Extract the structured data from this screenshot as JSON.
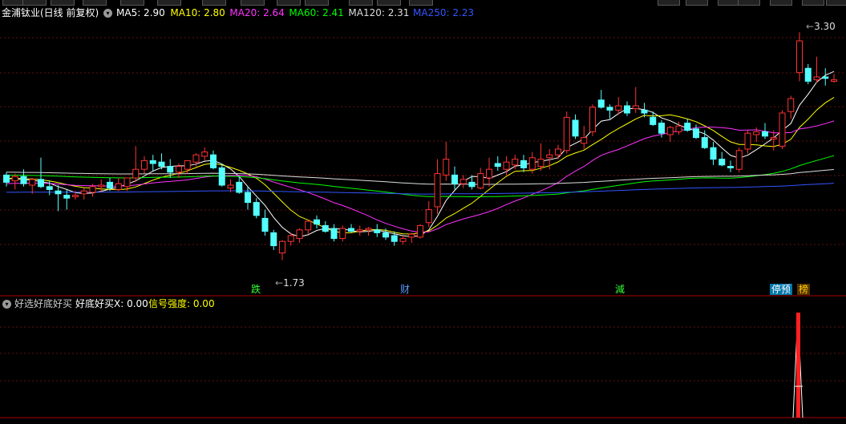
{
  "top_tabs": [
    "",
    "",
    "",
    "",
    "",
    "",
    "",
    "",
    "",
    "",
    "",
    "",
    ""
  ],
  "header": {
    "stock_title": "金浦钛业(日线 前复权)",
    "ma_labels": [
      {
        "label": "MA5: 2.90",
        "color": "#ffffff"
      },
      {
        "label": "MA10: 2.80",
        "color": "#ffff00"
      },
      {
        "label": "MA20: 2.64",
        "color": "#ff33ff"
      },
      {
        "label": "MA60: 2.41",
        "color": "#00ff00"
      },
      {
        "label": "MA120: 2.31",
        "color": "#dddddd"
      },
      {
        "label": "MA250: 2.23",
        "color": "#3355ff"
      }
    ]
  },
  "price_labels": {
    "high": "3.30",
    "low": "1.73"
  },
  "event_markers": [
    {
      "text": "跌",
      "color": "#33ff33",
      "bg": "transparent"
    },
    {
      "text": "财",
      "color": "#5599ff",
      "bg": "transparent"
    },
    {
      "text": "減",
      "color": "#33ff33",
      "bg": "transparent"
    },
    {
      "text": "停预",
      "color": "#ffffff",
      "bg": "#0077aa"
    },
    {
      "text": "榜",
      "color": "#ffcc00",
      "bg": "#553300"
    }
  ],
  "indicator": {
    "name": "好选好底好买",
    "value_label": "好底好买X: 0.00",
    "strength_label": "信号强度: 0.00"
  },
  "chart_data": {
    "type": "candlestick",
    "ylim": [
      1.6,
      3.4
    ],
    "candles": [
      [
        2.32,
        2.34,
        2.24,
        2.27
      ],
      [
        2.28,
        2.33,
        2.22,
        2.31
      ],
      [
        2.31,
        2.36,
        2.24,
        2.26
      ],
      [
        2.25,
        2.3,
        2.19,
        2.29
      ],
      [
        2.29,
        2.44,
        2.23,
        2.24
      ],
      [
        2.24,
        2.28,
        2.18,
        2.22
      ],
      [
        2.21,
        2.25,
        2.07,
        2.19
      ],
      [
        2.18,
        2.22,
        2.08,
        2.16
      ],
      [
        2.17,
        2.21,
        2.15,
        2.18
      ],
      [
        2.19,
        2.23,
        2.15,
        2.21
      ],
      [
        2.2,
        2.26,
        2.17,
        2.24
      ],
      [
        2.24,
        2.29,
        2.2,
        2.25
      ],
      [
        2.27,
        2.3,
        2.21,
        2.23
      ],
      [
        2.22,
        2.3,
        2.21,
        2.26
      ],
      [
        2.24,
        2.3,
        2.21,
        2.3
      ],
      [
        2.3,
        2.52,
        2.27,
        2.36
      ],
      [
        2.36,
        2.45,
        2.33,
        2.42
      ],
      [
        2.42,
        2.46,
        2.35,
        2.4
      ],
      [
        2.41,
        2.47,
        2.36,
        2.38
      ],
      [
        2.38,
        2.43,
        2.3,
        2.34
      ],
      [
        2.34,
        2.4,
        2.3,
        2.38
      ],
      [
        2.36,
        2.42,
        2.33,
        2.42
      ],
      [
        2.41,
        2.47,
        2.38,
        2.46
      ],
      [
        2.45,
        2.51,
        2.42,
        2.48
      ],
      [
        2.46,
        2.49,
        2.36,
        2.37
      ],
      [
        2.37,
        2.4,
        2.24,
        2.25
      ],
      [
        2.23,
        2.29,
        2.2,
        2.25
      ],
      [
        2.27,
        2.31,
        2.19,
        2.2
      ],
      [
        2.2,
        2.24,
        2.08,
        2.13
      ],
      [
        2.13,
        2.16,
        2.02,
        2.04
      ],
      [
        2.02,
        2.08,
        1.9,
        1.93
      ],
      [
        1.92,
        1.94,
        1.8,
        1.83
      ],
      [
        1.78,
        1.87,
        1.73,
        1.86
      ],
      [
        1.86,
        1.92,
        1.83,
        1.9
      ],
      [
        1.88,
        1.95,
        1.85,
        1.94
      ],
      [
        1.94,
        2.01,
        1.91,
        2.0
      ],
      [
        2.01,
        2.04,
        1.95,
        1.98
      ],
      [
        1.97,
        2.0,
        1.92,
        1.93
      ],
      [
        1.95,
        1.98,
        1.86,
        1.88
      ],
      [
        1.88,
        1.97,
        1.86,
        1.95
      ],
      [
        1.95,
        1.98,
        1.92,
        1.93
      ],
      [
        1.93,
        1.97,
        1.9,
        1.94
      ],
      [
        1.94,
        1.96,
        1.9,
        1.95
      ],
      [
        1.94,
        1.98,
        1.89,
        1.92
      ],
      [
        1.92,
        1.95,
        1.87,
        1.89
      ],
      [
        1.9,
        1.93,
        1.83,
        1.86
      ],
      [
        1.86,
        1.9,
        1.84,
        1.88
      ],
      [
        1.89,
        1.92,
        1.85,
        1.91
      ],
      [
        1.89,
        1.98,
        1.88,
        1.97
      ],
      [
        1.99,
        2.14,
        1.96,
        2.08
      ],
      [
        2.1,
        2.43,
        2.05,
        2.33
      ],
      [
        2.32,
        2.55,
        2.28,
        2.43
      ],
      [
        2.32,
        2.38,
        2.22,
        2.26
      ],
      [
        2.26,
        2.32,
        2.23,
        2.29
      ],
      [
        2.27,
        2.32,
        2.22,
        2.24
      ],
      [
        2.23,
        2.37,
        2.22,
        2.33
      ],
      [
        2.3,
        2.44,
        2.24,
        2.36
      ],
      [
        2.4,
        2.45,
        2.35,
        2.38
      ],
      [
        2.36,
        2.45,
        2.32,
        2.41
      ],
      [
        2.39,
        2.46,
        2.36,
        2.43
      ],
      [
        2.42,
        2.46,
        2.34,
        2.37
      ],
      [
        2.36,
        2.48,
        2.33,
        2.44
      ],
      [
        2.38,
        2.54,
        2.35,
        2.43
      ],
      [
        2.44,
        2.5,
        2.36,
        2.46
      ],
      [
        2.46,
        2.53,
        2.43,
        2.5
      ],
      [
        2.49,
        2.76,
        2.47,
        2.72
      ],
      [
        2.7,
        2.74,
        2.57,
        2.59
      ],
      [
        2.54,
        2.66,
        2.5,
        2.58
      ],
      [
        2.62,
        2.81,
        2.59,
        2.79
      ],
      [
        2.84,
        2.91,
        2.78,
        2.79
      ],
      [
        2.79,
        2.81,
        2.71,
        2.77
      ],
      [
        2.77,
        2.86,
        2.74,
        2.8
      ],
      [
        2.8,
        2.83,
        2.73,
        2.75
      ],
      [
        2.78,
        2.93,
        2.75,
        2.8
      ],
      [
        2.77,
        2.82,
        2.72,
        2.75
      ],
      [
        2.72,
        2.76,
        2.66,
        2.67
      ],
      [
        2.68,
        2.7,
        2.58,
        2.61
      ],
      [
        2.6,
        2.66,
        2.55,
        2.65
      ],
      [
        2.62,
        2.69,
        2.6,
        2.66
      ],
      [
        2.68,
        2.71,
        2.62,
        2.63
      ],
      [
        2.64,
        2.67,
        2.57,
        2.58
      ],
      [
        2.58,
        2.63,
        2.5,
        2.51
      ],
      [
        2.51,
        2.55,
        2.39,
        2.43
      ],
      [
        2.43,
        2.48,
        2.38,
        2.39
      ],
      [
        2.38,
        2.42,
        2.34,
        2.37
      ],
      [
        2.36,
        2.51,
        2.34,
        2.49
      ],
      [
        2.5,
        2.63,
        2.47,
        2.61
      ],
      [
        2.6,
        2.65,
        2.55,
        2.62
      ],
      [
        2.62,
        2.68,
        2.57,
        2.59
      ],
      [
        2.57,
        2.63,
        2.49,
        2.58
      ],
      [
        2.52,
        2.77,
        2.5,
        2.75
      ],
      [
        2.76,
        2.87,
        2.71,
        2.85
      ],
      [
        3.03,
        3.31,
        2.97,
        3.25
      ],
      [
        3.06,
        3.09,
        2.95,
        2.97
      ],
      [
        2.98,
        3.14,
        2.96,
        3.0
      ],
      [
        3.0,
        3.06,
        2.94,
        2.99
      ],
      [
        2.97,
        3.02,
        2.96,
        2.98
      ]
    ],
    "ma": [
      {
        "name": "MA5",
        "color": "#ffffff"
      },
      {
        "name": "MA10",
        "color": "#ffff00"
      },
      {
        "name": "MA20",
        "color": "#ff33ff"
      },
      {
        "name": "MA60",
        "color": "#00ff00"
      },
      {
        "name": "MA120",
        "color": "#dddddd"
      },
      {
        "name": "MA250",
        "color": "#3355ff"
      }
    ],
    "indicator_series": {
      "signal_index": 92,
      "value": 1,
      "ylim": [
        0,
        1.1
      ]
    }
  }
}
